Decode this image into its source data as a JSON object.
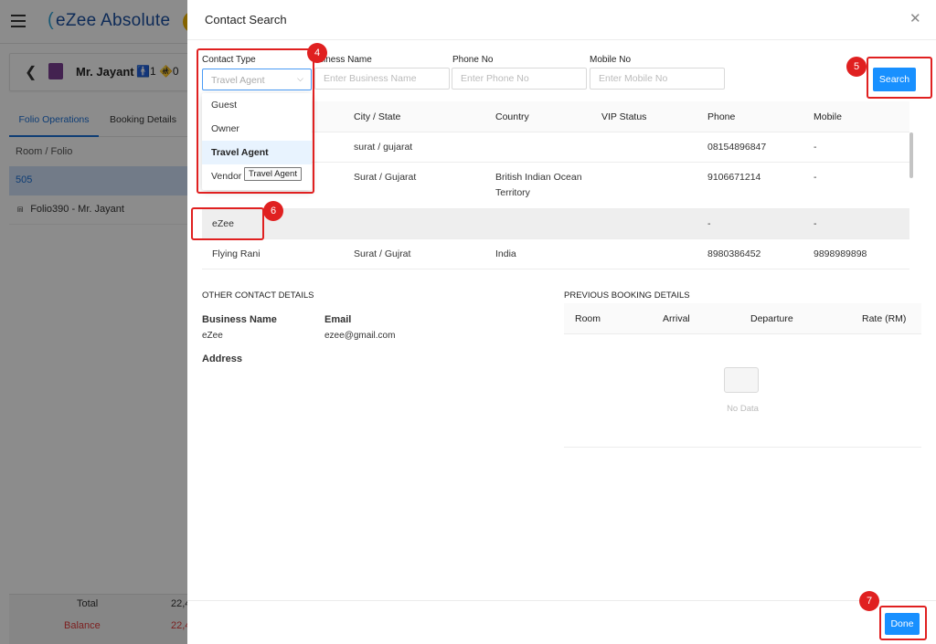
{
  "app": {
    "logo_text": "eZee Absolute",
    "guest_name": "Mr. Jayant",
    "pax": "🚹1 🚸0",
    "tabs": [
      "Folio Operations",
      "Booking Details"
    ],
    "room_folio_header": "Room / Folio",
    "selected_room": "505",
    "folio_item": "Folio390 - Mr. Jayant",
    "totals": {
      "total_label": "Total",
      "total_value": "22,4",
      "balance_label": "Balance",
      "balance_value": "22,4"
    }
  },
  "dialog": {
    "title": "Contact Search",
    "close_icon": "close-icon",
    "filters": {
      "contact_type_label": "Contact Type",
      "contact_type_value": "Travel Agent",
      "business_name_label": "Business Name",
      "business_name_label_visible": "siness Name",
      "business_name_placeholder": "Enter Business Name",
      "phone_label": "Phone No",
      "phone_placeholder": "Enter Phone No",
      "mobile_label": "Mobile No",
      "mobile_placeholder": "Enter Mobile No",
      "options": [
        "Guest",
        "Owner",
        "Travel Agent",
        "Vendor"
      ],
      "selected_option": "Travel Agent",
      "tooltip": "Travel Agent"
    },
    "search_label": "Search",
    "table": {
      "columns": [
        "City / State",
        "Country",
        "VIP Status",
        "Phone",
        "Mobile"
      ],
      "rows": [
        {
          "name": "",
          "city": "surat / gujarat",
          "country": "",
          "vip": "",
          "phone": "08154896847",
          "mobile": "-"
        },
        {
          "name": "",
          "city": "Surat / Gujarat",
          "country": "British Indian Ocean Territory",
          "vip": "",
          "phone": "9106671214",
          "mobile": "-"
        },
        {
          "name": "eZee",
          "city": "",
          "country": "",
          "vip": "",
          "phone": "-",
          "mobile": "-"
        },
        {
          "name": "Flying Rani",
          "city": "Surat / Gujrat",
          "country": "India",
          "vip": "",
          "phone": "8980386452",
          "mobile": "9898989898"
        }
      ]
    },
    "other_details": {
      "heading": "OTHER CONTACT DETAILS",
      "business_name_label": "Business Name",
      "business_name_value": "eZee",
      "email_label": "Email",
      "email_value": "ezee@gmail.com",
      "address_label": "Address"
    },
    "previous_booking": {
      "heading": "PREVIOUS BOOKING DETAILS",
      "columns": [
        "Room",
        "Arrival",
        "Departure",
        "Rate (RM)"
      ],
      "empty_text": "No Data"
    },
    "done_label": "Done"
  },
  "annotations": {
    "step_4": "4",
    "step_5": "5",
    "step_6": "6",
    "step_7": "7",
    "color": "#e02020"
  }
}
